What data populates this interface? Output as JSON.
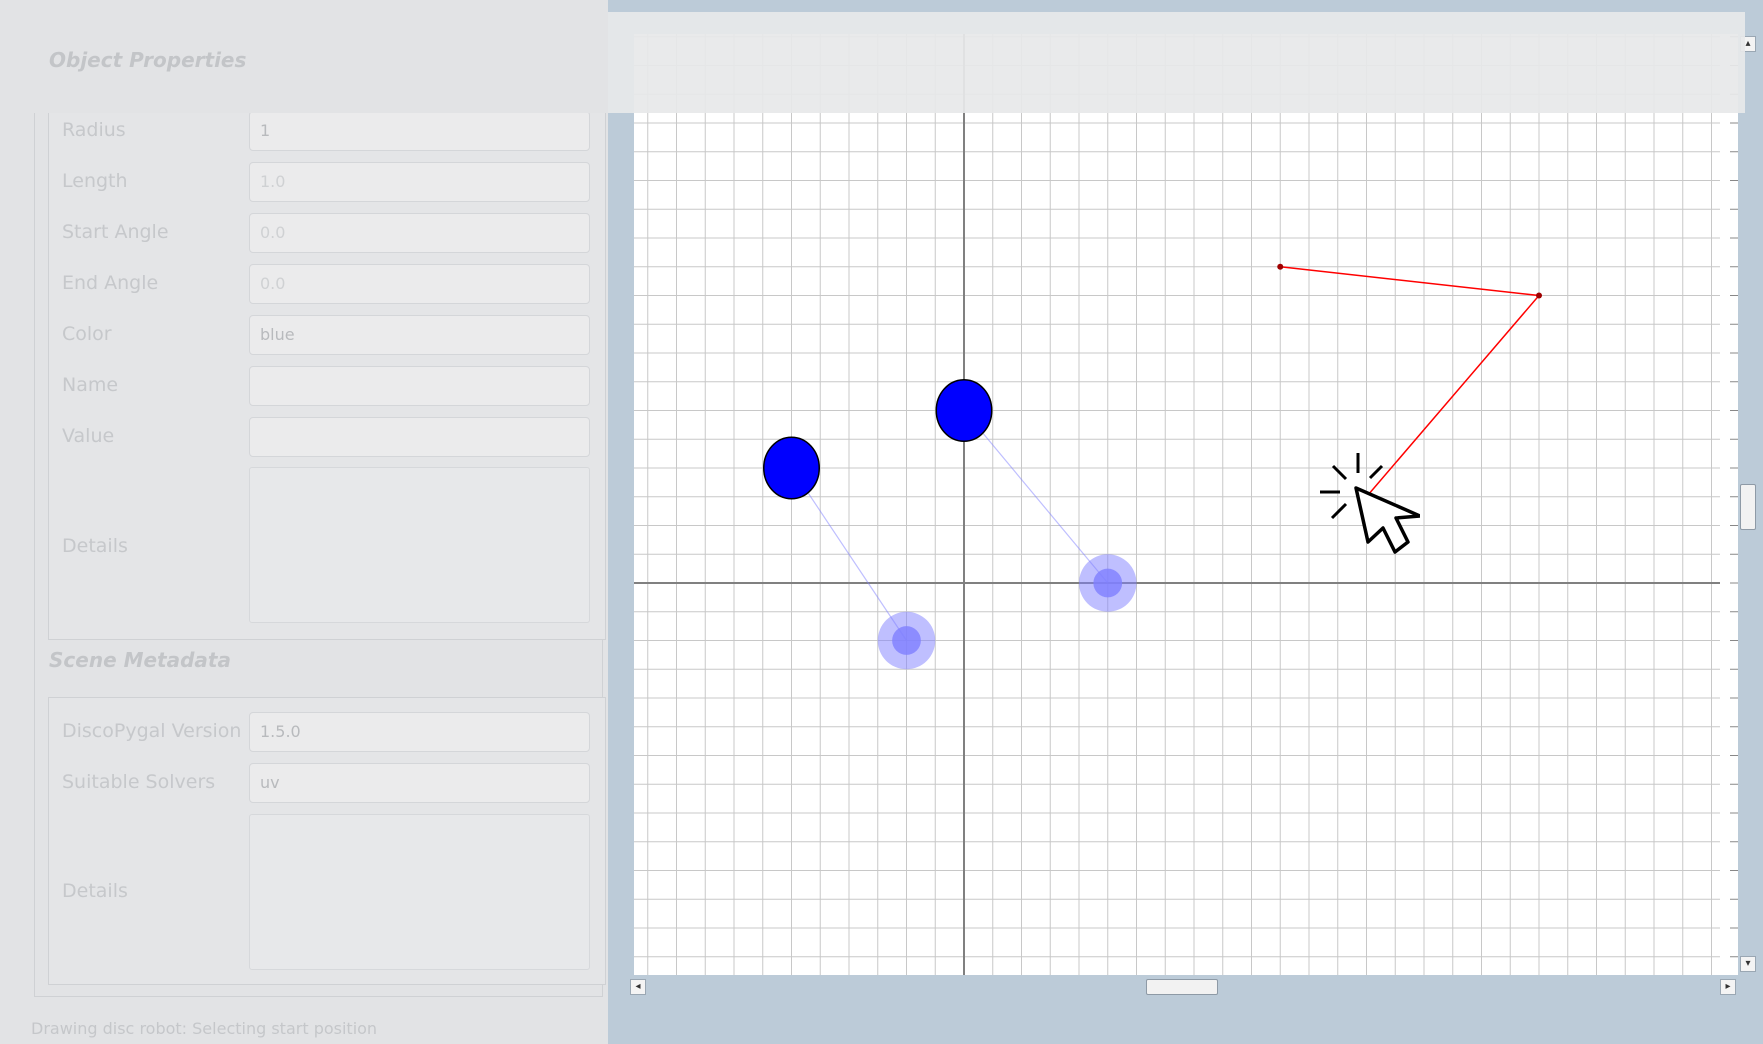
{
  "object_properties": {
    "title": "Object Properties",
    "fields": [
      {
        "label": "Radius",
        "value": "1",
        "disabled": false
      },
      {
        "label": "Length",
        "value": "1.0",
        "disabled": true
      },
      {
        "label": "Start Angle",
        "value": "0.0",
        "disabled": true
      },
      {
        "label": "End Angle",
        "value": "0.0",
        "disabled": true
      },
      {
        "label": "Color",
        "value": "blue",
        "disabled": false
      },
      {
        "label": "Name",
        "value": "",
        "disabled": false
      },
      {
        "label": "Value",
        "value": "",
        "disabled": false
      }
    ],
    "details_label": "Details",
    "details_value": ""
  },
  "scene_metadata": {
    "title": "Scene Metadata",
    "version_label": "DiscoPygal Version",
    "version_value": "1.5.0",
    "solvers_label": "Suitable Solvers",
    "solvers_value": "uv",
    "details_label": "Details",
    "details_value": ""
  },
  "status": {
    "text": "Drawing disc robot: Selecting start position"
  },
  "scene": {
    "robots": [
      {
        "start": [
          -3,
          2
        ],
        "goal": [
          -1,
          -1
        ],
        "radius": 1,
        "color": "blue"
      },
      {
        "start": [
          0,
          3
        ],
        "goal": [
          2.5,
          0
        ],
        "radius": 1,
        "color": "blue"
      }
    ],
    "polyline": {
      "color": "#ff0000",
      "points": [
        [
          5.5,
          5.5
        ],
        [
          10,
          5
        ],
        [
          7,
          1.5
        ]
      ]
    },
    "colors": {
      "robot": "#0000ff",
      "goal": "#8080ff",
      "grid": "#c8c8c8",
      "axis": "#808080",
      "path": "#ff0000"
    }
  },
  "icons": {
    "scroll_up": "▴",
    "scroll_down": "▾",
    "scroll_left": "◂",
    "scroll_right": "▸",
    "cursor": "click-cursor-icon"
  }
}
